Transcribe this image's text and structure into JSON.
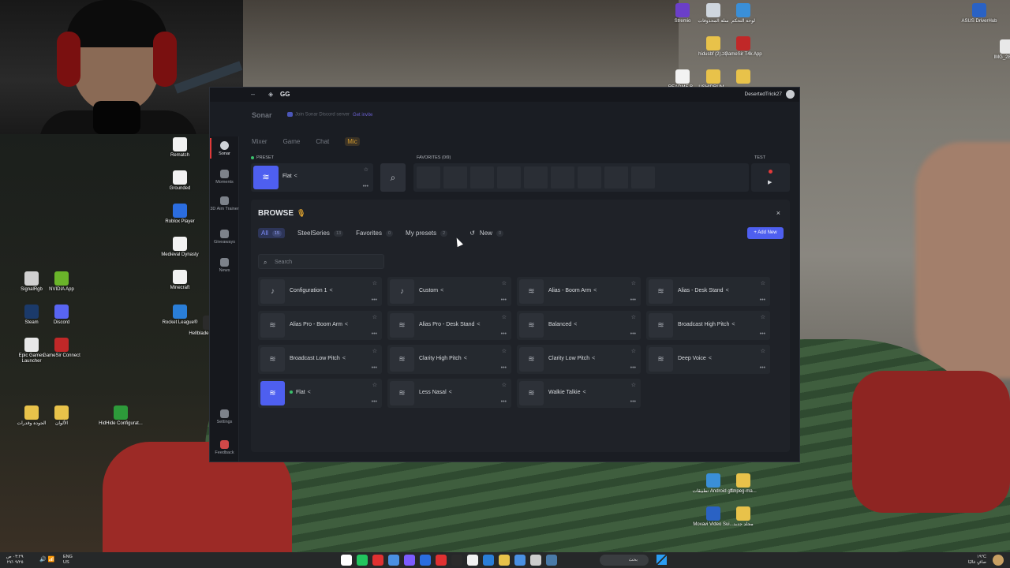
{
  "window": {
    "app_name": "GG",
    "minimize_glyph": "–",
    "logo_glyph": "◈",
    "username": "DesertedTrick27",
    "section_title": "Sonar",
    "discord_hint": "Join Sonar Discord server",
    "discord_link": "Get invite"
  },
  "sidebar": {
    "items": [
      {
        "label": "Sonar",
        "icon": "sonar-icon",
        "active": true
      },
      {
        "label": "Moments",
        "icon": "moments-icon"
      },
      {
        "label": "3D Aim Trainer",
        "icon": "aim-trainer-icon"
      },
      {
        "label": "Giveaways",
        "icon": "gift-icon"
      },
      {
        "label": "News",
        "icon": "news-icon"
      },
      {
        "label": "Settings",
        "icon": "gear-icon"
      },
      {
        "label": "Feedback",
        "icon": "feedback-icon"
      }
    ]
  },
  "tabs": [
    "Mixer",
    "Game",
    "Chat",
    "Mic"
  ],
  "active_tab": "Mic",
  "preset": {
    "label": "PRESET",
    "name": "Flat",
    "star": "☆",
    "dots": "•••",
    "share": "<"
  },
  "favorites": {
    "label": "FAVORITES (0/9)",
    "slots": 9
  },
  "test": {
    "label": "TEST",
    "play": "▶"
  },
  "browse": {
    "title": "BROWSE",
    "badge": "🎙",
    "close": "×",
    "filters": [
      {
        "label": "All",
        "count": "15",
        "active": true
      },
      {
        "label": "SteelSeries",
        "count": "13"
      },
      {
        "label": "Favorites",
        "count": "0"
      },
      {
        "label": "My presets",
        "count": "2"
      },
      {
        "label": "New",
        "count": "0",
        "refresh": "↺"
      }
    ],
    "add_new": "+ Add New",
    "search_placeholder": "Search",
    "search_glyph": "⌕",
    "presets": [
      {
        "name": "Configuration 1",
        "icon": "mic-icon"
      },
      {
        "name": "Custom",
        "icon": "mic-icon"
      },
      {
        "name": "Alias - Boom Arm",
        "icon": "waveform-icon"
      },
      {
        "name": "Alias - Desk Stand",
        "icon": "waveform-icon"
      },
      {
        "name": "Alias Pro - Boom Arm",
        "icon": "waveform-icon"
      },
      {
        "name": "Alias Pro - Desk Stand",
        "icon": "waveform-icon"
      },
      {
        "name": "Balanced",
        "icon": "waveform-icon"
      },
      {
        "name": "Broadcast High Pitch",
        "icon": "waveform-icon"
      },
      {
        "name": "Broadcast Low Pitch",
        "icon": "waveform-icon"
      },
      {
        "name": "Clarity High Pitch",
        "icon": "waveform-icon"
      },
      {
        "name": "Clarity Low Pitch",
        "icon": "waveform-icon"
      },
      {
        "name": "Deep Voice",
        "icon": "waveform-icon"
      },
      {
        "name": "Flat",
        "icon": "waveform-icon",
        "selected": true
      },
      {
        "name": "Less Nasal",
        "icon": "waveform-icon"
      },
      {
        "name": "Walkie Talkie",
        "icon": "waveform-icon"
      }
    ]
  },
  "desktop_icons": [
    {
      "label": "Stremio",
      "color": "#6b3fc9"
    },
    {
      "label": "سلة المحذوفات",
      "color": "#cfd6de"
    },
    {
      "label": "لوحة التحكم",
      "color": "#3a8fd8"
    },
    {
      "label": "ASUS DriverHub",
      "color": "#2a62c4"
    },
    {
      "label": "hidusbf (2).zip",
      "color": "#e8c24a"
    },
    {
      "label": "GameSir T4k App",
      "color": "#c02828"
    },
    {
      "label": "IMG_2802...",
      "color": "#e8e8e8"
    },
    {
      "label": "README.B...",
      "color": "#f2f2f2"
    },
    {
      "label": "USHIDRUM...",
      "color": "#e8c24a"
    },
    {
      "label": "...",
      "color": "#e8c24a"
    },
    {
      "label": "Rematch",
      "color": "#f2f2f2"
    },
    {
      "label": "Grounded",
      "color": "#f2f2f2"
    },
    {
      "label": "Roblox Player",
      "color": "#2b6de0"
    },
    {
      "label": "Medieval Dynasty",
      "color": "#f2f2f2"
    },
    {
      "label": "Minecraft",
      "color": "#f2f2f2"
    },
    {
      "label": "SignalRgb",
      "color": "#d0d0d0"
    },
    {
      "label": "NVIDIA App",
      "color": "#6ab42a"
    },
    {
      "label": "Rocket League®",
      "color": "#2a7ed8"
    },
    {
      "label": "Hellblade Senua's...",
      "color": "#2b2b2b"
    },
    {
      "label": "Steam",
      "color": "#1b3a6a"
    },
    {
      "label": "Discord",
      "color": "#5865f2"
    },
    {
      "label": "Epic Games Launcher",
      "color": "#e8e8e8"
    },
    {
      "label": "GameSir Connect",
      "color": "#c02828"
    },
    {
      "label": "الجودة وقدرات",
      "color": "#e8c24a"
    },
    {
      "label": "الألوان",
      "color": "#e8c24a"
    },
    {
      "label": "HidHide Configurat...",
      "color": "#2d9a3a"
    },
    {
      "label": "تطبيقات Android g...",
      "color": "#3a8fd8"
    },
    {
      "label": "ffmpeg-ma...",
      "color": "#e8c24a"
    },
    {
      "label": "Movavi Video Sui...",
      "color": "#2a62c4"
    },
    {
      "label": "مجلد جديد",
      "color": "#e8c24a"
    }
  ],
  "taskbar": {
    "time": "٠٣:٢٩ ص",
    "date": "٢٧/٠٩/٢٥",
    "lang": "ENG",
    "region": "US",
    "search_text": "بحث",
    "weather_temp": "١٩°C",
    "weather_desc": "صافٍ غالبًا",
    "apps": [
      "#ffffff",
      "#22c55e",
      "#e03131",
      "#4a90e2",
      "#7c5cff",
      "#2b6de0",
      "#e03131",
      "#2b2b2b",
      "#f2f2f2",
      "#2a7ed8",
      "#e8c24a",
      "#4a90e2",
      "#cccccc",
      "#4a7aa8"
    ]
  }
}
